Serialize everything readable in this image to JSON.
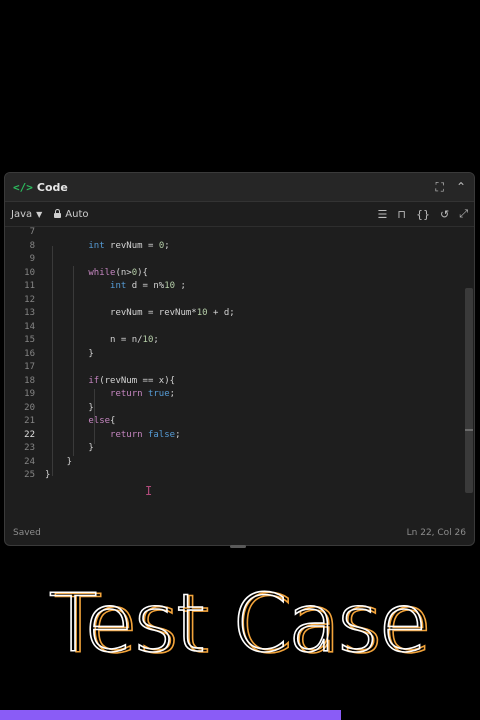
{
  "panel": {
    "title": "Code",
    "language": "Java",
    "mode": "Auto"
  },
  "editor": {
    "lines": [
      {
        "n": "7",
        "tokens": []
      },
      {
        "n": "8",
        "tokens": [
          [
            "        ",
            ""
          ],
          [
            "int",
            "kw"
          ],
          [
            " revNum = ",
            ""
          ],
          [
            "0",
            "num"
          ],
          [
            ";",
            ""
          ]
        ]
      },
      {
        "n": "9",
        "tokens": []
      },
      {
        "n": "10",
        "tokens": [
          [
            "        ",
            ""
          ],
          [
            "while",
            "ctl"
          ],
          [
            "(n>",
            ""
          ],
          [
            "0",
            "num"
          ],
          [
            "){",
            ""
          ]
        ]
      },
      {
        "n": "11",
        "tokens": [
          [
            "            ",
            ""
          ],
          [
            "int",
            "kw"
          ],
          [
            " d = n%",
            ""
          ],
          [
            "10",
            "num"
          ],
          [
            " ;",
            ""
          ]
        ]
      },
      {
        "n": "12",
        "tokens": []
      },
      {
        "n": "13",
        "tokens": [
          [
            "            revNum = revNum*",
            ""
          ],
          [
            "10",
            "num"
          ],
          [
            " + d;",
            ""
          ]
        ]
      },
      {
        "n": "14",
        "tokens": []
      },
      {
        "n": "15",
        "tokens": [
          [
            "            n = n/",
            ""
          ],
          [
            "10",
            "num"
          ],
          [
            ";",
            ""
          ]
        ]
      },
      {
        "n": "16",
        "tokens": [
          [
            "        }",
            ""
          ]
        ]
      },
      {
        "n": "17",
        "tokens": []
      },
      {
        "n": "18",
        "tokens": [
          [
            "        ",
            ""
          ],
          [
            "if",
            "ctl"
          ],
          [
            "(revNum == x){",
            ""
          ]
        ]
      },
      {
        "n": "19",
        "tokens": [
          [
            "            ",
            ""
          ],
          [
            "return",
            "ctl"
          ],
          [
            " ",
            ""
          ],
          [
            "true",
            "lit"
          ],
          [
            ";",
            ""
          ]
        ]
      },
      {
        "n": "20",
        "tokens": [
          [
            "        }",
            ""
          ]
        ]
      },
      {
        "n": "21",
        "tokens": [
          [
            "        ",
            ""
          ],
          [
            "else",
            "ctl"
          ],
          [
            "{",
            ""
          ]
        ]
      },
      {
        "n": "22",
        "tokens": [
          [
            "            ",
            ""
          ],
          [
            "return",
            "ctl"
          ],
          [
            " ",
            ""
          ],
          [
            "false",
            "lit"
          ],
          [
            ";",
            ""
          ]
        ]
      },
      {
        "n": "23",
        "tokens": [
          [
            "        }",
            ""
          ]
        ]
      },
      {
        "n": "24",
        "tokens": [
          [
            "    }",
            ""
          ]
        ]
      },
      {
        "n": "25",
        "tokens": [
          [
            "}",
            ""
          ]
        ]
      }
    ],
    "active_line": "22"
  },
  "status": {
    "save_state": "Saved",
    "cursor_pos": "Ln 22, Col 26"
  },
  "banner": {
    "text": "Test Case"
  },
  "progress": {
    "fraction": 0.71
  },
  "colors": {
    "accent_green": "#2cbb5d",
    "progress_purple": "#8a5cf6",
    "banner_orange": "#f2a33a"
  }
}
